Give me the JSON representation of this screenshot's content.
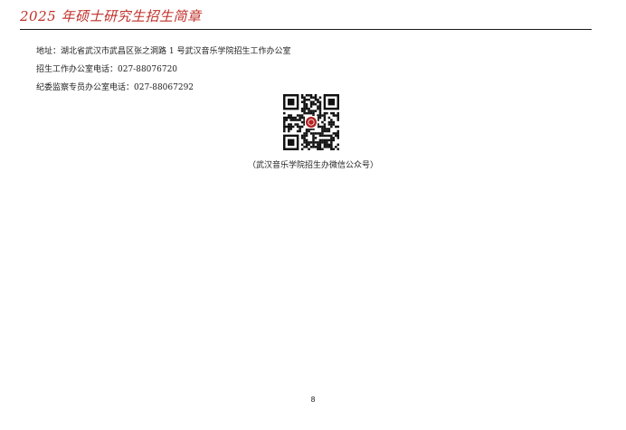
{
  "header": {
    "title": "2025 年硕士研究生招生简章"
  },
  "contact": {
    "address": "地址：湖北省武汉市武昌区张之洞路 1 号武汉音乐学院招生工作办公室",
    "admissions_phone": "招生工作办公室电话：027-88076720",
    "discipline_phone": "纪委监察专员办公室电话：027-88067292"
  },
  "qr": {
    "caption": "（武汉音乐学院招生办微信公众号）"
  },
  "footer": {
    "page_number": "8"
  },
  "colors": {
    "header_title": "#c0302a",
    "rule": "#1a1a1a",
    "text": "#222222",
    "qr_dark": "#111111",
    "qr_logo": "#b22222"
  },
  "icons": {
    "qr": "qr-code-icon",
    "logo": "school-emblem-icon"
  }
}
